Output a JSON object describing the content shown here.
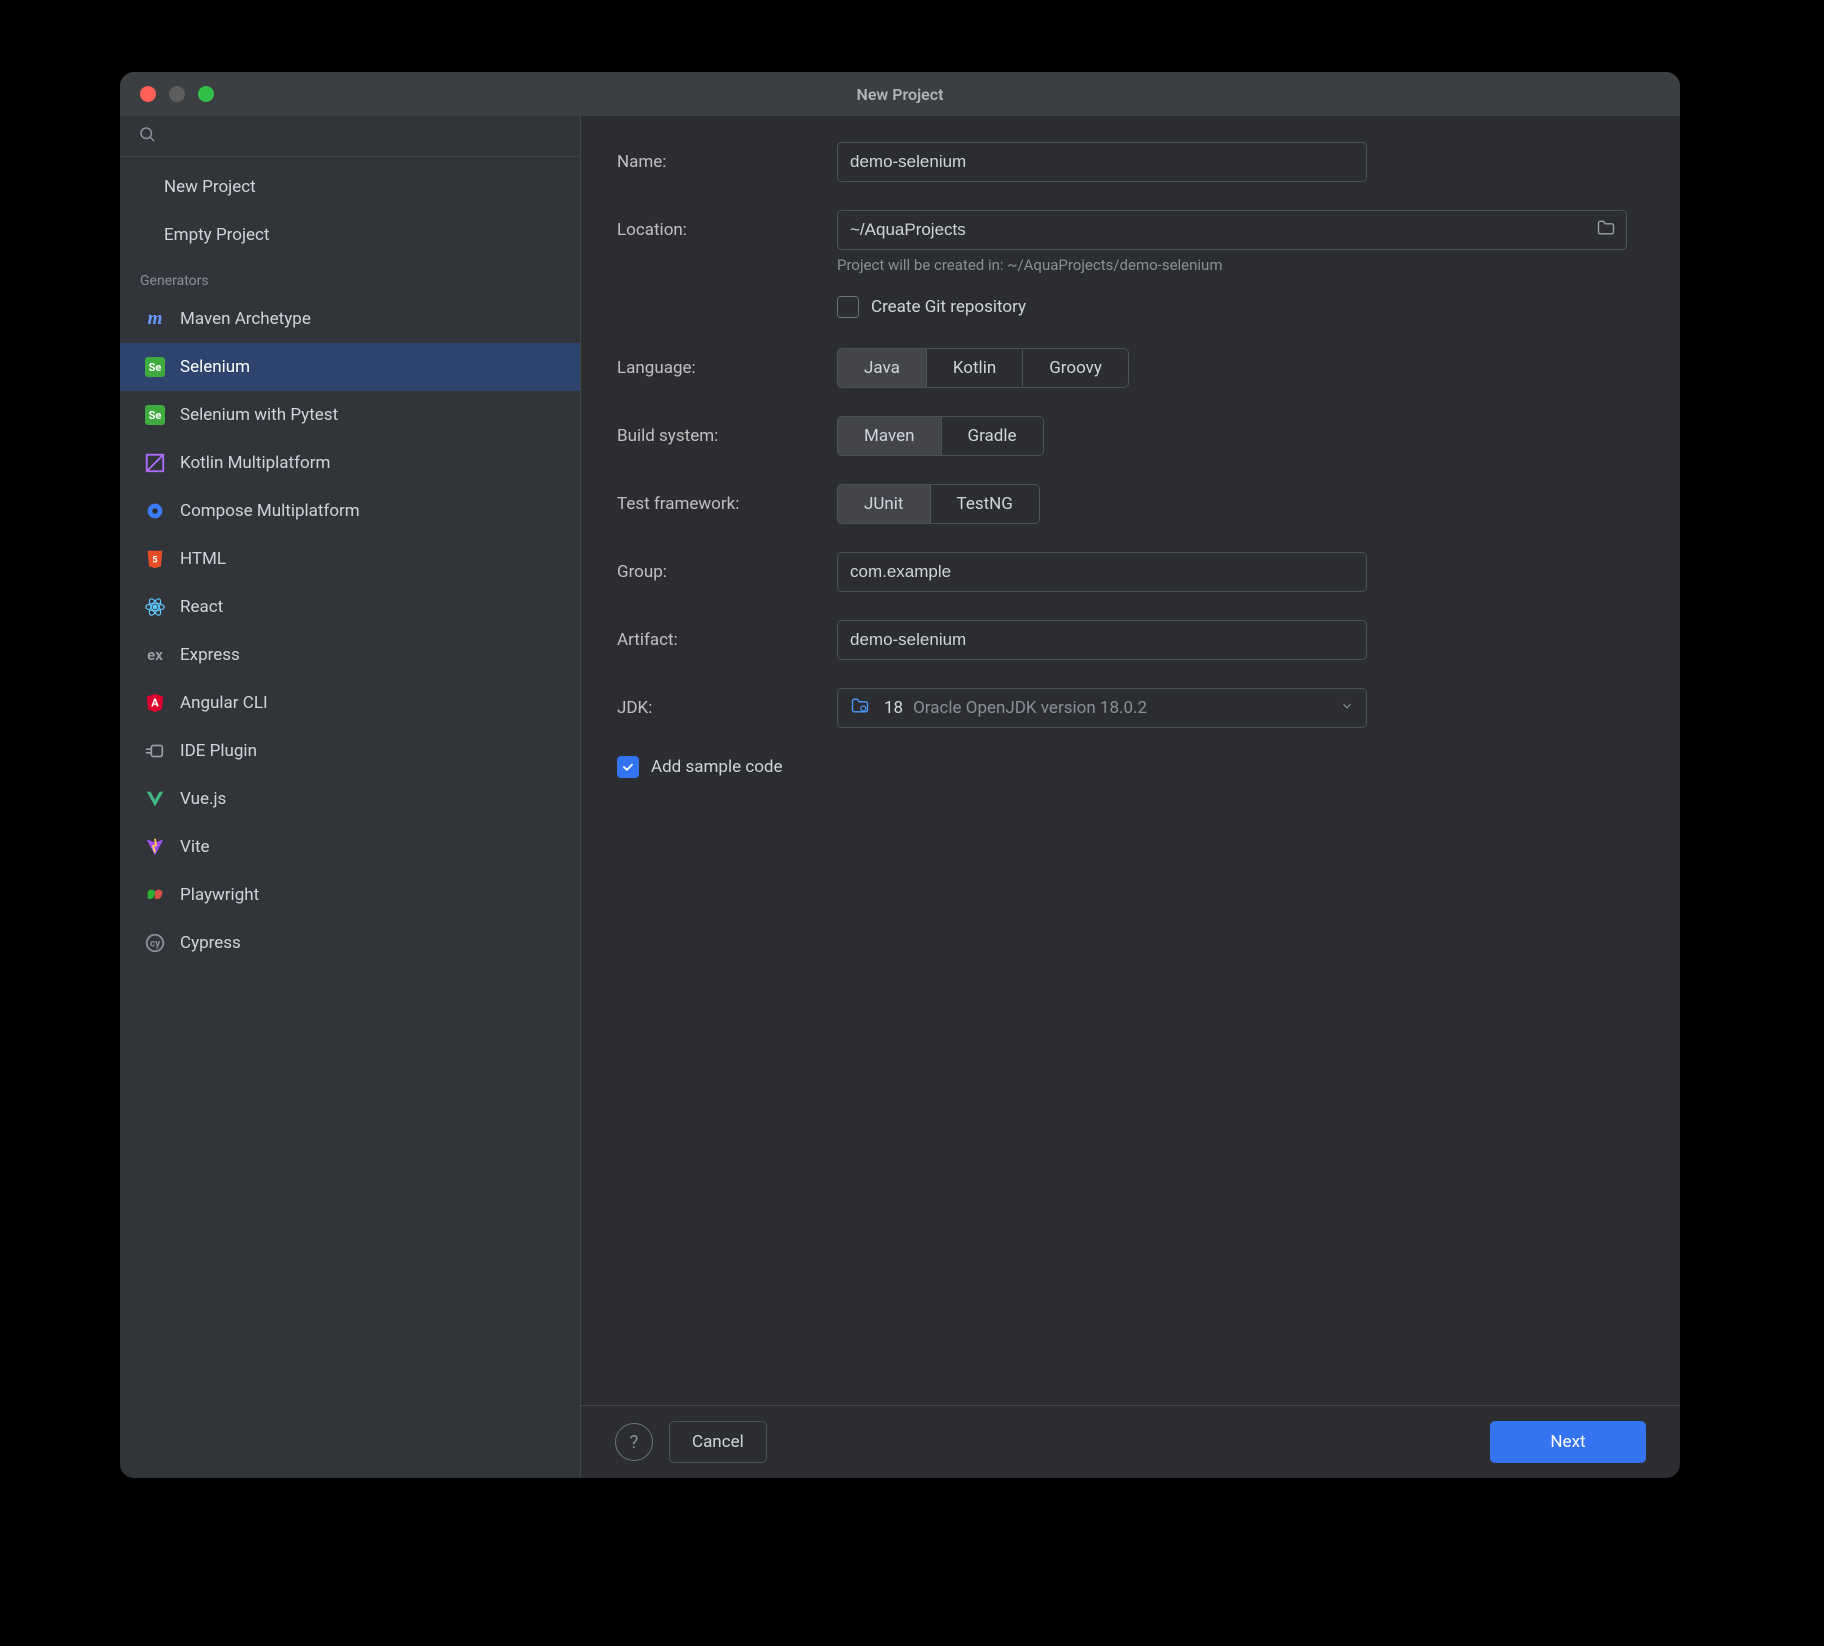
{
  "window": {
    "title": "New Project"
  },
  "sidebar": {
    "project_items": [
      {
        "label": "New Project"
      },
      {
        "label": "Empty Project"
      }
    ],
    "generators_header": "Generators",
    "generators": [
      {
        "label": "Maven Archetype",
        "icon": "maven"
      },
      {
        "label": "Selenium",
        "icon": "selenium",
        "selected": true
      },
      {
        "label": "Selenium with Pytest",
        "icon": "selenium"
      },
      {
        "label": "Kotlin Multiplatform",
        "icon": "kotlin-mp"
      },
      {
        "label": "Compose Multiplatform",
        "icon": "compose"
      },
      {
        "label": "HTML",
        "icon": "html"
      },
      {
        "label": "React",
        "icon": "react"
      },
      {
        "label": "Express",
        "icon": "express"
      },
      {
        "label": "Angular CLI",
        "icon": "angular"
      },
      {
        "label": "IDE Plugin",
        "icon": "plugin"
      },
      {
        "label": "Vue.js",
        "icon": "vue"
      },
      {
        "label": "Vite",
        "icon": "vite"
      },
      {
        "label": "Playwright",
        "icon": "playwright"
      },
      {
        "label": "Cypress",
        "icon": "cypress"
      }
    ]
  },
  "form": {
    "name_label": "Name:",
    "name_value": "demo-selenium",
    "location_label": "Location:",
    "location_value": "~/AquaProjects",
    "location_hint": "Project will be created in: ~/AquaProjects/demo-selenium",
    "create_git_label": "Create Git repository",
    "create_git_checked": false,
    "language_label": "Language:",
    "language_options": [
      "Java",
      "Kotlin",
      "Groovy"
    ],
    "language_selected": "Java",
    "build_label": "Build system:",
    "build_options": [
      "Maven",
      "Gradle"
    ],
    "build_selected": "Maven",
    "test_label": "Test framework:",
    "test_options": [
      "JUnit",
      "TestNG"
    ],
    "test_selected": "JUnit",
    "group_label": "Group:",
    "group_value": "com.example",
    "artifact_label": "Artifact:",
    "artifact_value": "demo-selenium",
    "jdk_label": "JDK:",
    "jdk_number": "18",
    "jdk_desc": "Oracle OpenJDK version 18.0.2",
    "sample_label": "Add sample code",
    "sample_checked": true
  },
  "footer": {
    "cancel": "Cancel",
    "next": "Next"
  }
}
